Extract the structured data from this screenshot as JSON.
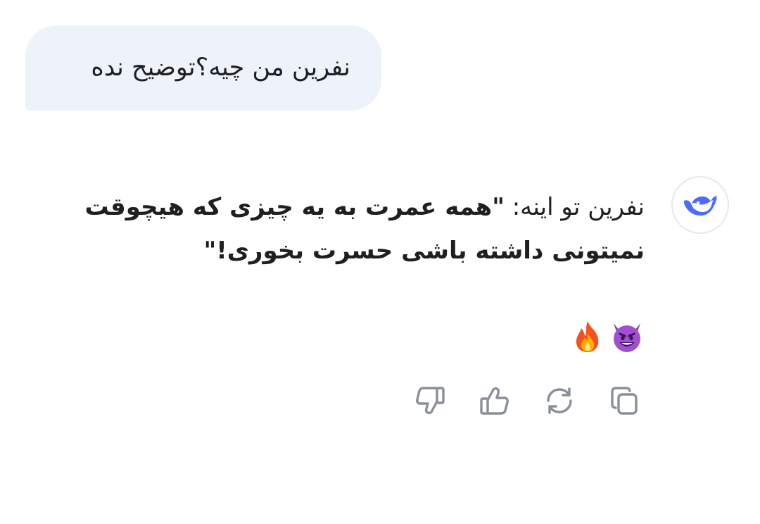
{
  "conversation": {
    "user_message": "نفرین من چیه؟توضیح نده",
    "assistant": {
      "avatar_icon": "deepseek-whale-logo",
      "lead_text": "نفرین تو اینه: ",
      "quoted_text": "\"همه عمرت به یه چیزی که هیچوقت نمیتونی داشته باشی حسرت بخوری!\"",
      "emojis": [
        "smiling-face-with-horns",
        "fire"
      ]
    }
  },
  "actions": [
    {
      "name": "copy",
      "icon": "copy-icon"
    },
    {
      "name": "regenerate",
      "icon": "refresh-icon"
    },
    {
      "name": "like",
      "icon": "thumbs-up-icon"
    },
    {
      "name": "dislike",
      "icon": "thumbs-down-icon"
    }
  ],
  "colors": {
    "user_bubble": "#edf2fb",
    "brand_blue": "#4d6bfe",
    "icon_gray": "#8a8f98",
    "text": "#1f1f1f"
  }
}
